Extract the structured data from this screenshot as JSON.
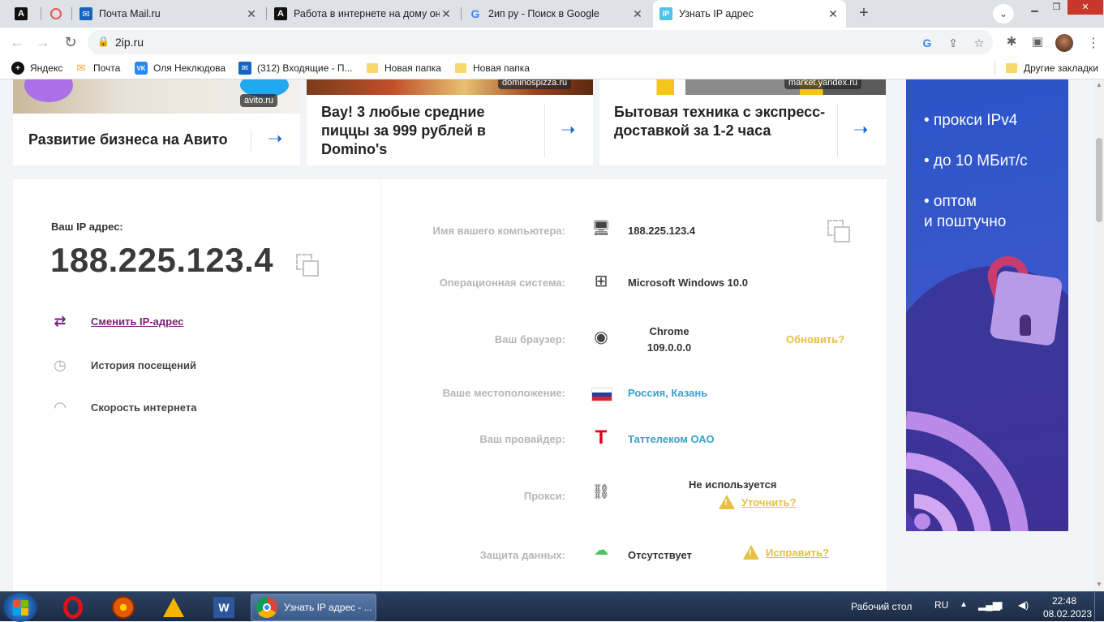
{
  "browser": {
    "tabs": [
      {
        "title": "",
        "favicon": "A"
      },
      {
        "title": "",
        "favicon": "pin"
      },
      {
        "title": "Почта Mail.ru",
        "favicon": "mail"
      },
      {
        "title": "Работа в интернете на дому онл",
        "favicon": "A"
      },
      {
        "title": "2ип ру - Поиск в Google",
        "favicon": "G"
      },
      {
        "title": "Узнать IP адрес",
        "favicon": "IP"
      }
    ],
    "url": "2ip.ru",
    "bookmarks": [
      {
        "label": "Яндекс"
      },
      {
        "label": "Почта"
      },
      {
        "label": "Оля Неклюдова"
      },
      {
        "label": "(312) Входящие - П..."
      },
      {
        "label": "Новая папка"
      },
      {
        "label": "Новая папка"
      }
    ],
    "other_bookmarks": "Другие закладки"
  },
  "ads": {
    "card1": {
      "title": "Развитие бизнеса на Авито",
      "domain": "avito.ru"
    },
    "card2": {
      "title": "Вау! 3 любые средние пиццы за 999 рублей в Domino's",
      "domain": "dominospizza.ru"
    },
    "card3": {
      "title": "Бытовая техника с экспресс-доставкой за 1-2 часа",
      "domain": "market.yandex.ru"
    },
    "sidebar": {
      "line1": "• прокси IPv4",
      "line2": "• до 10 МБит/с",
      "line3": "• оптом",
      "line4": "и поштучно"
    }
  },
  "ip": {
    "label": "Ваш IP адрес:",
    "value": "188.225.123.4"
  },
  "menu": {
    "change_ip": "Сменить IP-адрес",
    "history": "История посещений",
    "speed": "Скорость интернета"
  },
  "info": {
    "computer_name": {
      "label": "Имя вашего компьютера:",
      "value": "188.225.123.4"
    },
    "os": {
      "label": "Операционная система:",
      "value": "Microsoft Windows 10.0"
    },
    "browser": {
      "label": "Ваш браузер:",
      "value_line1": "Chrome",
      "value_line2": "109.0.0.0",
      "update": "Обновить?"
    },
    "location": {
      "label": "Ваше местоположение:",
      "value": "Россия, Казань"
    },
    "provider": {
      "label": "Ваш провайдер:",
      "value": "Таттелеком ОАО"
    },
    "proxy": {
      "label": "Прокси:",
      "value": "Не используется",
      "action": "Уточнить?"
    },
    "protection": {
      "label": "Защита данных:",
      "value": "Отсутствует",
      "action": "Исправить?"
    }
  },
  "taskbar": {
    "task_title": "Узнать IP адрес - ...",
    "desktop": "Рабочий стол",
    "lang": "RU",
    "time": "22:48",
    "date": "08.02.2023"
  },
  "colors": {
    "accent_link": "#7a1e7e",
    "blue_value": "#3aa0c9",
    "warning": "#e6c040",
    "ad_arrow": "#1e6bd6"
  }
}
